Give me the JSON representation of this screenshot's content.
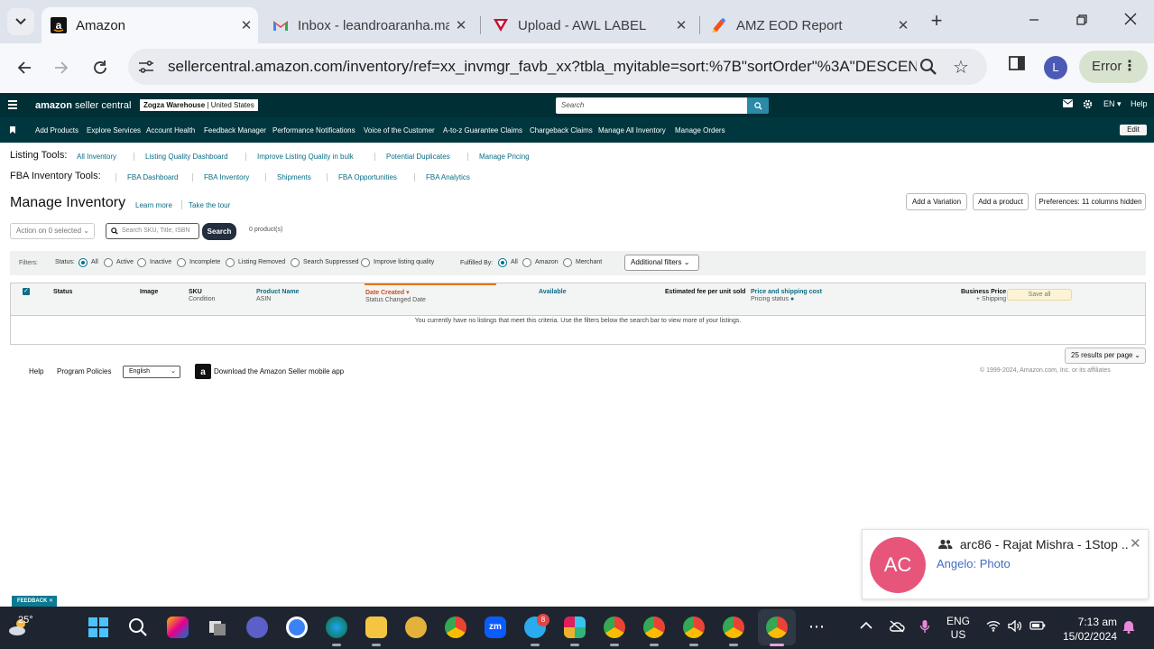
{
  "browser": {
    "tabs": [
      {
        "title": "Amazon",
        "active": true
      },
      {
        "title": "Inbox - leandroaranha.ma"
      },
      {
        "title": "Upload - AWL LABEL"
      },
      {
        "title": "AMZ EOD Report"
      }
    ],
    "url": "sellercentral.amazon.com/inventory/ref=xx_invmgr_favb_xx?tbla_myitable=sort:%7B\"sortOrder\"%3A\"DESCENDI...",
    "profile_initial": "L",
    "error_label": "Error"
  },
  "seller_header": {
    "logo_brand": "amazon",
    "logo_suffix": "seller central",
    "store_name": "Zogza Warehouse",
    "store_region": "United States",
    "search_placeholder": "Search",
    "language": "EN",
    "help": "Help"
  },
  "nav": {
    "items": [
      "Add Products",
      "Explore Services",
      "Account Health",
      "Feedback Manager",
      "Performance Notifications",
      "Voice of the Customer",
      "A-to-z Guarantee Claims",
      "Chargeback Claims",
      "Manage All Inventory",
      "Manage Orders"
    ],
    "edit": "Edit"
  },
  "listing_tools": {
    "label": "Listing Tools:",
    "links": [
      "All Inventory",
      "Listing Quality Dashboard",
      "Improve Listing Quality in bulk",
      "Potential Duplicates",
      "Manage Pricing"
    ]
  },
  "fba_tools": {
    "label": "FBA Inventory Tools:",
    "links": [
      "FBA Dashboard",
      "FBA Inventory",
      "Shipments",
      "FBA Opportunities",
      "FBA Analytics"
    ]
  },
  "page": {
    "title": "Manage Inventory",
    "learn_more": "Learn more",
    "take_tour": "Take the tour",
    "add_variation": "Add a Variation",
    "add_product": "Add a product",
    "preferences": "Preferences: 11 columns hidden"
  },
  "actions": {
    "action_dropdown": "Action on 0 selected",
    "search_placeholder": "Search SKU, Title, ISBN",
    "search_button": "Search",
    "product_count": "0 product(s)"
  },
  "filters": {
    "label": "Filters:",
    "status_label": "Status:",
    "status_options": [
      "All",
      "Active",
      "Inactive",
      "Incomplete",
      "Listing Removed",
      "Search Suppressed",
      "Improve listing quality"
    ],
    "fulfilled_label": "Fulfilled By:",
    "fulfilled_options": [
      "All",
      "Amazon",
      "Merchant"
    ],
    "additional": "Additional filters"
  },
  "table": {
    "columns": {
      "status": "Status",
      "image": "Image",
      "sku": "SKU",
      "sku_sub": "Condition",
      "product_name": "Product Name",
      "product_sub": "ASIN",
      "date_created": "Date Created",
      "date_sub": "Status Changed Date",
      "available": "Available",
      "est_fee": "Estimated fee per unit sold",
      "price_shipping": "Price and shipping cost",
      "pricing_status": "Pricing status",
      "business_price": "Business Price",
      "shipping_sub": "+ Shipping"
    },
    "save_all": "Save all",
    "empty_message": "You currently have no listings that meet this criteria. Use the filters below the search bar to view more of your listings.",
    "results_per_page": "25 results per page"
  },
  "footer": {
    "help": "Help",
    "program_policies": "Program Policies",
    "language": "English",
    "mobile_app": "Download the Amazon Seller mobile app",
    "copyright": "© 1999-2024, Amazon.com, Inc. or its affiliates"
  },
  "feedback": "FEEDBACK",
  "notification": {
    "avatar": "AC",
    "title": "arc86 - Rajat Mishra - 1Stop ...",
    "sender": "Angelo:",
    "message": "Photo"
  },
  "taskbar": {
    "weather": "25°",
    "telegram_badge": "8",
    "lang_top": "ENG",
    "lang_bottom": "US",
    "time": "7:13 am",
    "date": "15/02/2024"
  },
  "colors": {
    "seller_header": "#002f36",
    "seller_nav": "#00373f",
    "link": "#0a6d84",
    "sort_accent": "#e77600",
    "notification_avatar": "#e8557a"
  }
}
